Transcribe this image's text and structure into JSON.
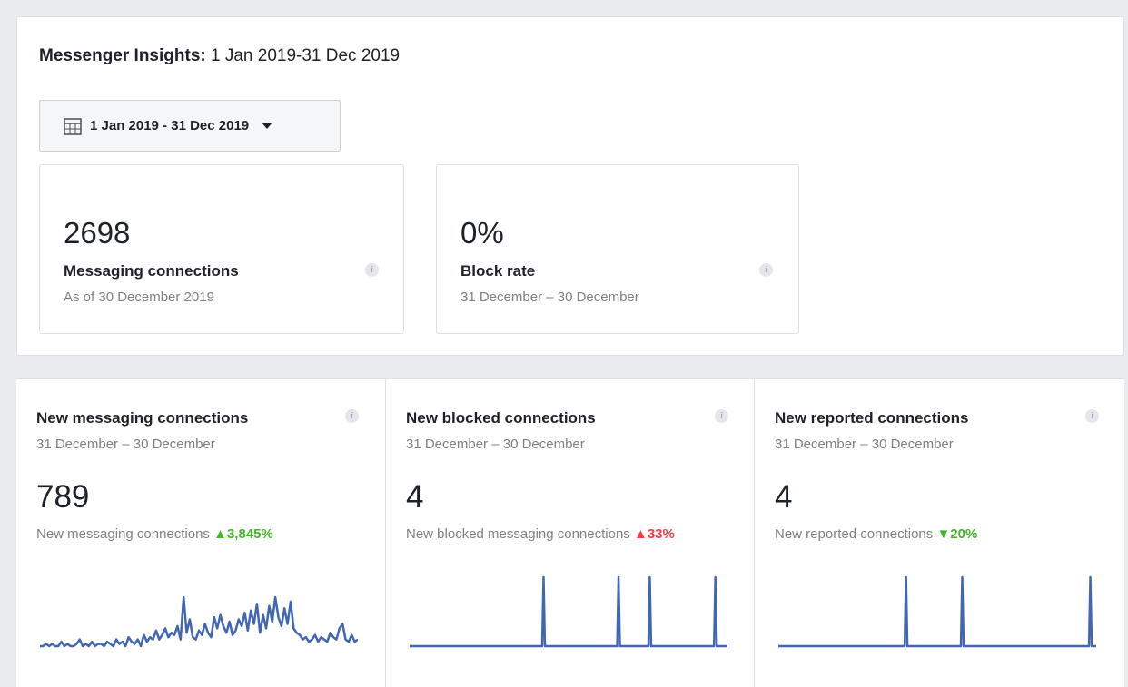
{
  "header": {
    "title_bold": "Messenger Insights:",
    "title_range": "1 Jan 2019-31 Dec 2019"
  },
  "date_picker": {
    "label": "1 Jan 2019 - 31 Dec 2019",
    "icon": "calendar-icon"
  },
  "summary_cards": [
    {
      "value": "2698",
      "label": "Messaging connections",
      "subtitle": "As of 30 December 2019"
    },
    {
      "value": "0%",
      "label": "Block rate",
      "subtitle": "31 December – 30 December"
    }
  ],
  "metrics": [
    {
      "title": "New messaging connections",
      "subtitle": "31 December – 30 December",
      "value": "789",
      "description": "New messaging connections",
      "change": "3,845%",
      "change_arrow": "▲",
      "change_color": "#42b72a",
      "chart_data": {
        "type": "line",
        "values": [
          0,
          0,
          1,
          0,
          1,
          0,
          0,
          2,
          0,
          1,
          0,
          0,
          1,
          3,
          0,
          1,
          0,
          2,
          0,
          1,
          1,
          0,
          2,
          1,
          0,
          3,
          1,
          2,
          0,
          4,
          2,
          1,
          3,
          0,
          5,
          2,
          4,
          3,
          7,
          3,
          5,
          8,
          4,
          6,
          5,
          9,
          3,
          22,
          6,
          12,
          4,
          3,
          7,
          5,
          10,
          6,
          4,
          13,
          8,
          14,
          9,
          6,
          11,
          5,
          7,
          12,
          9,
          15,
          7,
          16,
          10,
          19,
          6,
          14,
          8,
          18,
          11,
          22,
          13,
          9,
          17,
          10,
          20,
          8,
          6,
          5,
          3,
          4,
          2,
          3,
          5,
          2,
          4,
          3,
          2,
          6,
          4,
          3,
          8,
          10,
          3,
          2,
          5,
          2,
          3
        ],
        "color": "#4267b2"
      }
    },
    {
      "title": "New blocked connections",
      "subtitle": "31 December – 30 December",
      "value": "4",
      "description": "New blocked messaging connections",
      "change": "33%",
      "change_arrow": "▲",
      "change_color": "#fa3e3e",
      "chart_data": {
        "type": "line",
        "spikes": [
          0.42,
          0.66,
          0.76,
          0.97
        ],
        "values": [
          0,
          1
        ],
        "color": "#4267b2"
      }
    },
    {
      "title": "New reported connections",
      "subtitle": "31 December – 30 December",
      "value": "4",
      "description": "New reported connections",
      "change": "20%",
      "change_arrow": "▼",
      "change_color": "#42b72a",
      "chart_data": {
        "type": "line",
        "spikes": [
          0.4,
          0.58,
          0.99
        ],
        "values": [
          0,
          1
        ],
        "color": "#4267b2"
      }
    }
  ]
}
